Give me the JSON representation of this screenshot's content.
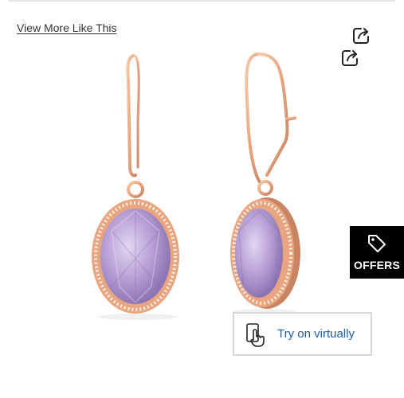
{
  "page": {
    "view_more_link": "View More Like This",
    "share_icons": [
      "share-icon",
      "share-icon"
    ],
    "product_image": {
      "subject": "rose gold oval amethyst halo leverback drop earrings",
      "colors": {
        "metal": "#e8a57f",
        "stone": "#b8a1d6",
        "stone_dark": "#8e75b5",
        "diamond": "#f4efe8"
      }
    },
    "offers": {
      "label": "OFFERS",
      "icon": "tag-icon",
      "background": "#000000"
    },
    "try_on": {
      "label": "Try on virtually",
      "icon": "hand-touch-icon",
      "color": "#1f5fa8"
    }
  }
}
